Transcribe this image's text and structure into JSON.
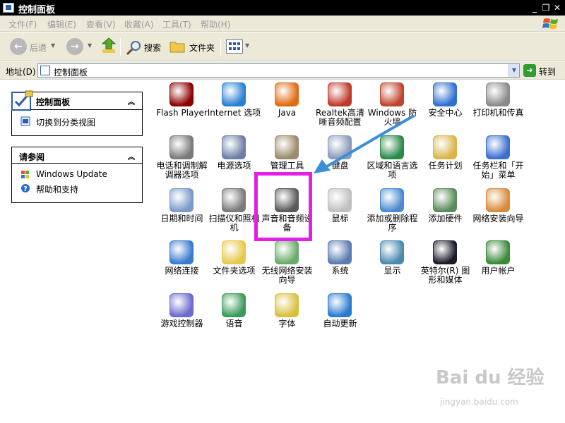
{
  "window": {
    "title": "控制面板",
    "controls": [
      "_",
      "❐",
      "✕"
    ]
  },
  "menubar": {
    "items": [
      "文件(F)",
      "编辑(E)",
      "查看(V)",
      "收藏(A)",
      "工具(T)",
      "帮助(H)"
    ]
  },
  "toolbar": {
    "back_label": "后退",
    "search_label": "搜索",
    "folders_label": "文件夹"
  },
  "address": {
    "label": "地址(D)",
    "value": "控制面板",
    "go_label": "转到"
  },
  "sidebar": {
    "panel1": {
      "title": "控制面板",
      "items": [
        {
          "label": "切换到分类视图",
          "icon": "switch-view-icon"
        }
      ]
    },
    "panel2": {
      "title": "请参阅",
      "items": [
        {
          "label": "Windows Update",
          "icon": "windows-update-icon"
        },
        {
          "label": "帮助和支持",
          "icon": "help-icon"
        }
      ]
    }
  },
  "items": [
    {
      "label": "Flash Player",
      "icon": "flash-icon",
      "color": "#8b0000"
    },
    {
      "label": "Internet 选项",
      "icon": "internet-options-icon",
      "color": "#2a7fd4"
    },
    {
      "label": "Java",
      "icon": "java-icon",
      "color": "#e06a12"
    },
    {
      "label": "Realtek高清晰音频配置",
      "icon": "realtek-audio-icon",
      "color": "#c0392b"
    },
    {
      "label": "Windows 防火墙",
      "icon": "firewall-icon",
      "color": "#c0442b"
    },
    {
      "label": "安全中心",
      "icon": "security-center-icon",
      "color": "#2f6fcf"
    },
    {
      "label": "打印机和传真",
      "icon": "printer-fax-icon",
      "color": "#8a8a8a"
    },
    {
      "label": "电话和调制解调器选项",
      "icon": "phone-modem-icon",
      "color": "#7a7a7a"
    },
    {
      "label": "电源选项",
      "icon": "power-options-icon",
      "color": "#6b7fa8"
    },
    {
      "label": "管理工具",
      "icon": "admin-tools-icon",
      "color": "#9c8a6a"
    },
    {
      "label": "键盘",
      "icon": "keyboard-icon",
      "color": "#8a9aba"
    },
    {
      "label": "区域和语言选项",
      "icon": "region-language-icon",
      "color": "#2a8a4a"
    },
    {
      "label": "任务计划",
      "icon": "scheduled-tasks-icon",
      "color": "#d9b54a"
    },
    {
      "label": "任务栏和「开始」菜单",
      "icon": "taskbar-start-icon",
      "color": "#3b6fd0"
    },
    {
      "label": "日期和时间",
      "icon": "date-time-icon",
      "color": "#7a9aca"
    },
    {
      "label": "扫描仪和照相机",
      "icon": "scanner-camera-icon",
      "color": "#7a7a7a"
    },
    {
      "label": "声音和音频设备",
      "icon": "sound-audio-icon",
      "color": "#5a5a5a"
    },
    {
      "label": "鼠标",
      "icon": "mouse-icon",
      "color": "#c0c0c0"
    },
    {
      "label": "添加或删除程序",
      "icon": "add-remove-programs-icon",
      "color": "#4a8ad0"
    },
    {
      "label": "添加硬件",
      "icon": "add-hardware-icon",
      "color": "#5a8a5a"
    },
    {
      "label": "网络安装向导",
      "icon": "network-setup-icon",
      "color": "#d98a3a"
    },
    {
      "label": "网络连接",
      "icon": "network-connections-icon",
      "color": "#3a7ad0"
    },
    {
      "label": "文件夹选项",
      "icon": "folder-options-icon",
      "color": "#e8c84a"
    },
    {
      "label": "无线网络安装向导",
      "icon": "wireless-setup-icon",
      "color": "#6aaa6a"
    },
    {
      "label": "系统",
      "icon": "system-icon",
      "color": "#5a7ab0"
    },
    {
      "label": "显示",
      "icon": "display-icon",
      "color": "#4a8ab0"
    },
    {
      "label": "英特尔(R) 图形和媒体",
      "icon": "intel-graphics-icon",
      "color": "#1a1a2a"
    },
    {
      "label": "用户帐户",
      "icon": "user-accounts-icon",
      "color": "#3a8a3a"
    },
    {
      "label": "游戏控制器",
      "icon": "game-controllers-icon",
      "color": "#6a6ad0"
    },
    {
      "label": "语音",
      "icon": "speech-icon",
      "color": "#3a9a5a"
    },
    {
      "label": "字体",
      "icon": "fonts-icon",
      "color": "#d9c040"
    },
    {
      "label": "自动更新",
      "icon": "automatic-updates-icon",
      "color": "#2a7ad0"
    }
  ],
  "annotation": {
    "highlight_color": "#e61fe6",
    "arrow_color": "#3a8fd8"
  },
  "watermark": {
    "brand": "Bai du 经验",
    "url": "jingyan.baidu.com"
  }
}
